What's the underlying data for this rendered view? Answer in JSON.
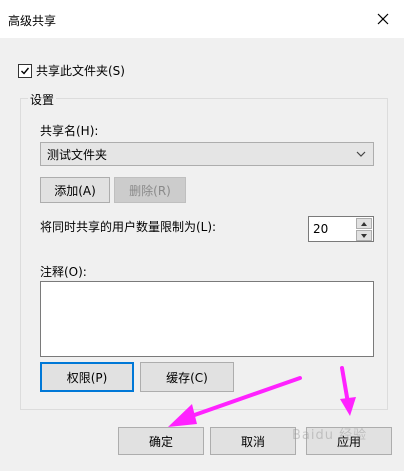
{
  "window": {
    "title": "高级共享",
    "close_icon": "close-icon"
  },
  "share_checkbox": {
    "label": "共享此文件夹(S)",
    "checked": true
  },
  "settings_group": {
    "label": "设置",
    "share_name_label": "共享名(H):",
    "share_name_value": "测试文件夹",
    "add_label": "添加(A)",
    "delete_label": "删除(R)",
    "user_limit_label": "将同时共享的用户数量限制为(L):",
    "user_limit_value": "20",
    "comment_label": "注释(O):",
    "comment_value": "",
    "permissions_label": "权限(P)",
    "cache_label": "缓存(C)"
  },
  "footer": {
    "ok_label": "确定",
    "cancel_label": "取消",
    "apply_label": "应用"
  },
  "colors": {
    "annotation_arrow": "#ff22ff",
    "focus_border": "#0078d7"
  }
}
